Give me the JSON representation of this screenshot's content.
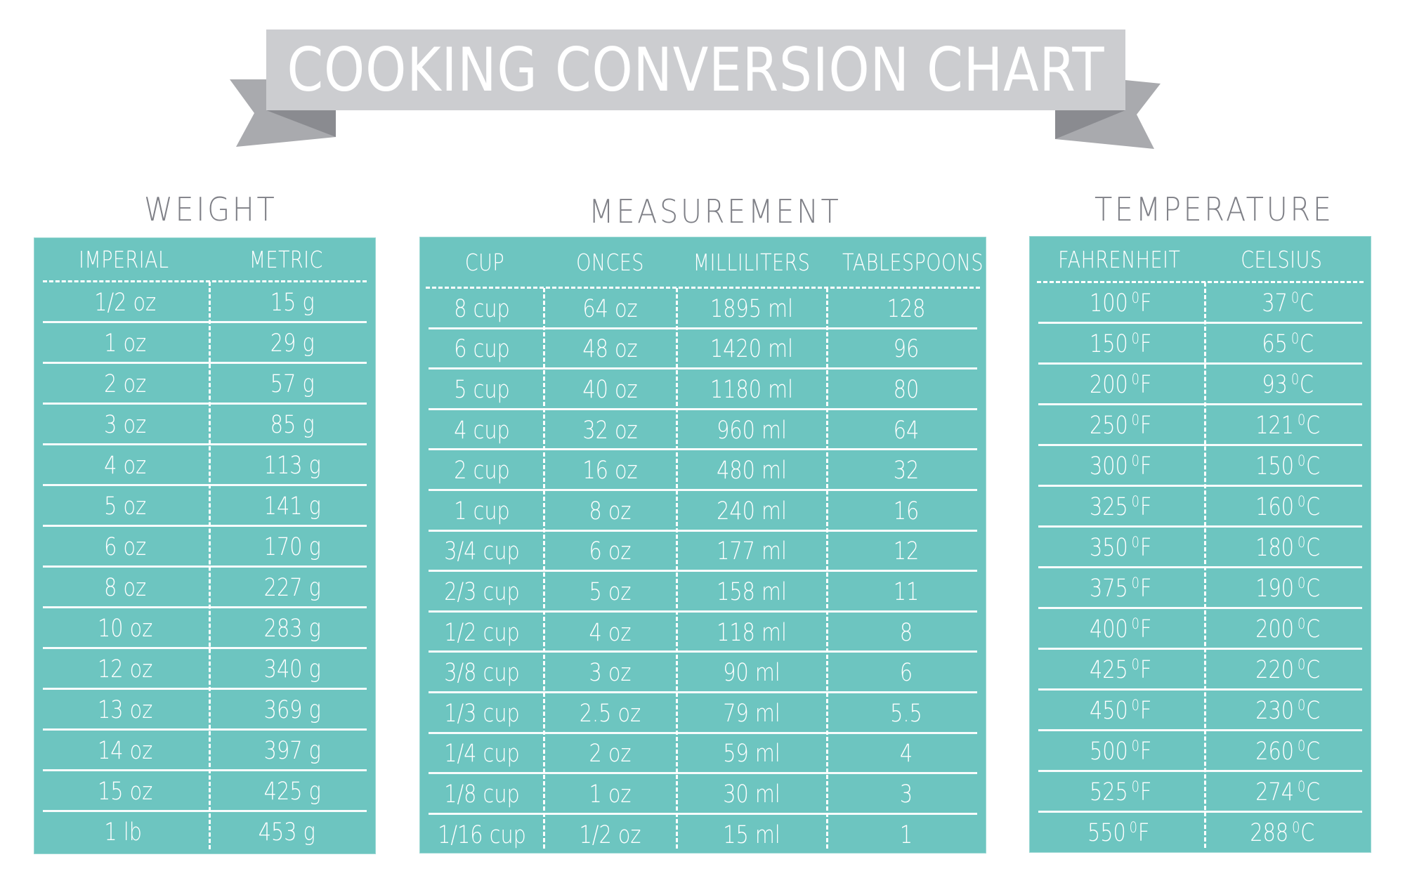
{
  "title": "COOKING CONVERSION CHART",
  "colors": {
    "panel_teal": "#6dc5c0",
    "banner_light": "#cccdd0",
    "banner_tail": "#a9aaae",
    "banner_fold": "#8a8b90",
    "heading_gray": "#7f8087",
    "text_white": "#ffffff"
  },
  "sections": {
    "weight": {
      "heading": "WEIGHT",
      "columns": [
        "IMPERIAL",
        "METRIC"
      ],
      "rows": [
        [
          "1/2 oz",
          "15 g"
        ],
        [
          "1 oz",
          "29 g"
        ],
        [
          "2 oz",
          "57 g"
        ],
        [
          "3 oz",
          "85 g"
        ],
        [
          "4 oz",
          "113 g"
        ],
        [
          "5 oz",
          "141 g"
        ],
        [
          "6 oz",
          "170 g"
        ],
        [
          "8 oz",
          "227 g"
        ],
        [
          "10 oz",
          "283 g"
        ],
        [
          "12 oz",
          "340 g"
        ],
        [
          "13 oz",
          "369 g"
        ],
        [
          "14 oz",
          "397 g"
        ],
        [
          "15 oz",
          "425 g"
        ],
        [
          "1 lb",
          "453 g"
        ]
      ]
    },
    "measurement": {
      "heading": "MEASUREMENT",
      "columns": [
        "CUP",
        "ONCES",
        "MILLILITERS",
        "TABLESPOONS"
      ],
      "rows": [
        [
          "8 cup",
          "64 oz",
          "1895 ml",
          "128"
        ],
        [
          "6 cup",
          "48 oz",
          "1420 ml",
          "96"
        ],
        [
          "5 cup",
          "40 oz",
          "1180 ml",
          "80"
        ],
        [
          "4 cup",
          "32 oz",
          "960 ml",
          "64"
        ],
        [
          "2 cup",
          "16 oz",
          "480 ml",
          "32"
        ],
        [
          "1 cup",
          "8 oz",
          "240 ml",
          "16"
        ],
        [
          "3/4 cup",
          "6 oz",
          "177 ml",
          "12"
        ],
        [
          "2/3 cup",
          "5 oz",
          "158 ml",
          "11"
        ],
        [
          "1/2 cup",
          "4 oz",
          "118 ml",
          "8"
        ],
        [
          "3/8 cup",
          "3 oz",
          "90 ml",
          "6"
        ],
        [
          "1/3 cup",
          "2.5 oz",
          "79 ml",
          "5.5"
        ],
        [
          "1/4 cup",
          "2 oz",
          "59 ml",
          "4"
        ],
        [
          "1/8 cup",
          "1 oz",
          "30 ml",
          "3"
        ],
        [
          "1/16 cup",
          "1/2 oz",
          "15 ml",
          "1"
        ]
      ]
    },
    "temperature": {
      "heading": "TEMPERATURE",
      "columns": [
        "FAHRENHEIT",
        "CELSIUS"
      ],
      "degree_mark": "0",
      "units": [
        "F",
        "C"
      ],
      "rows": [
        [
          "100",
          "37"
        ],
        [
          "150",
          "65"
        ],
        [
          "200",
          "93"
        ],
        [
          "250",
          "121"
        ],
        [
          "300",
          "150"
        ],
        [
          "325",
          "160"
        ],
        [
          "350",
          "180"
        ],
        [
          "375",
          "190"
        ],
        [
          "400",
          "200"
        ],
        [
          "425",
          "220"
        ],
        [
          "450",
          "230"
        ],
        [
          "500",
          "260"
        ],
        [
          "525",
          "274"
        ],
        [
          "550",
          "288"
        ]
      ]
    }
  }
}
